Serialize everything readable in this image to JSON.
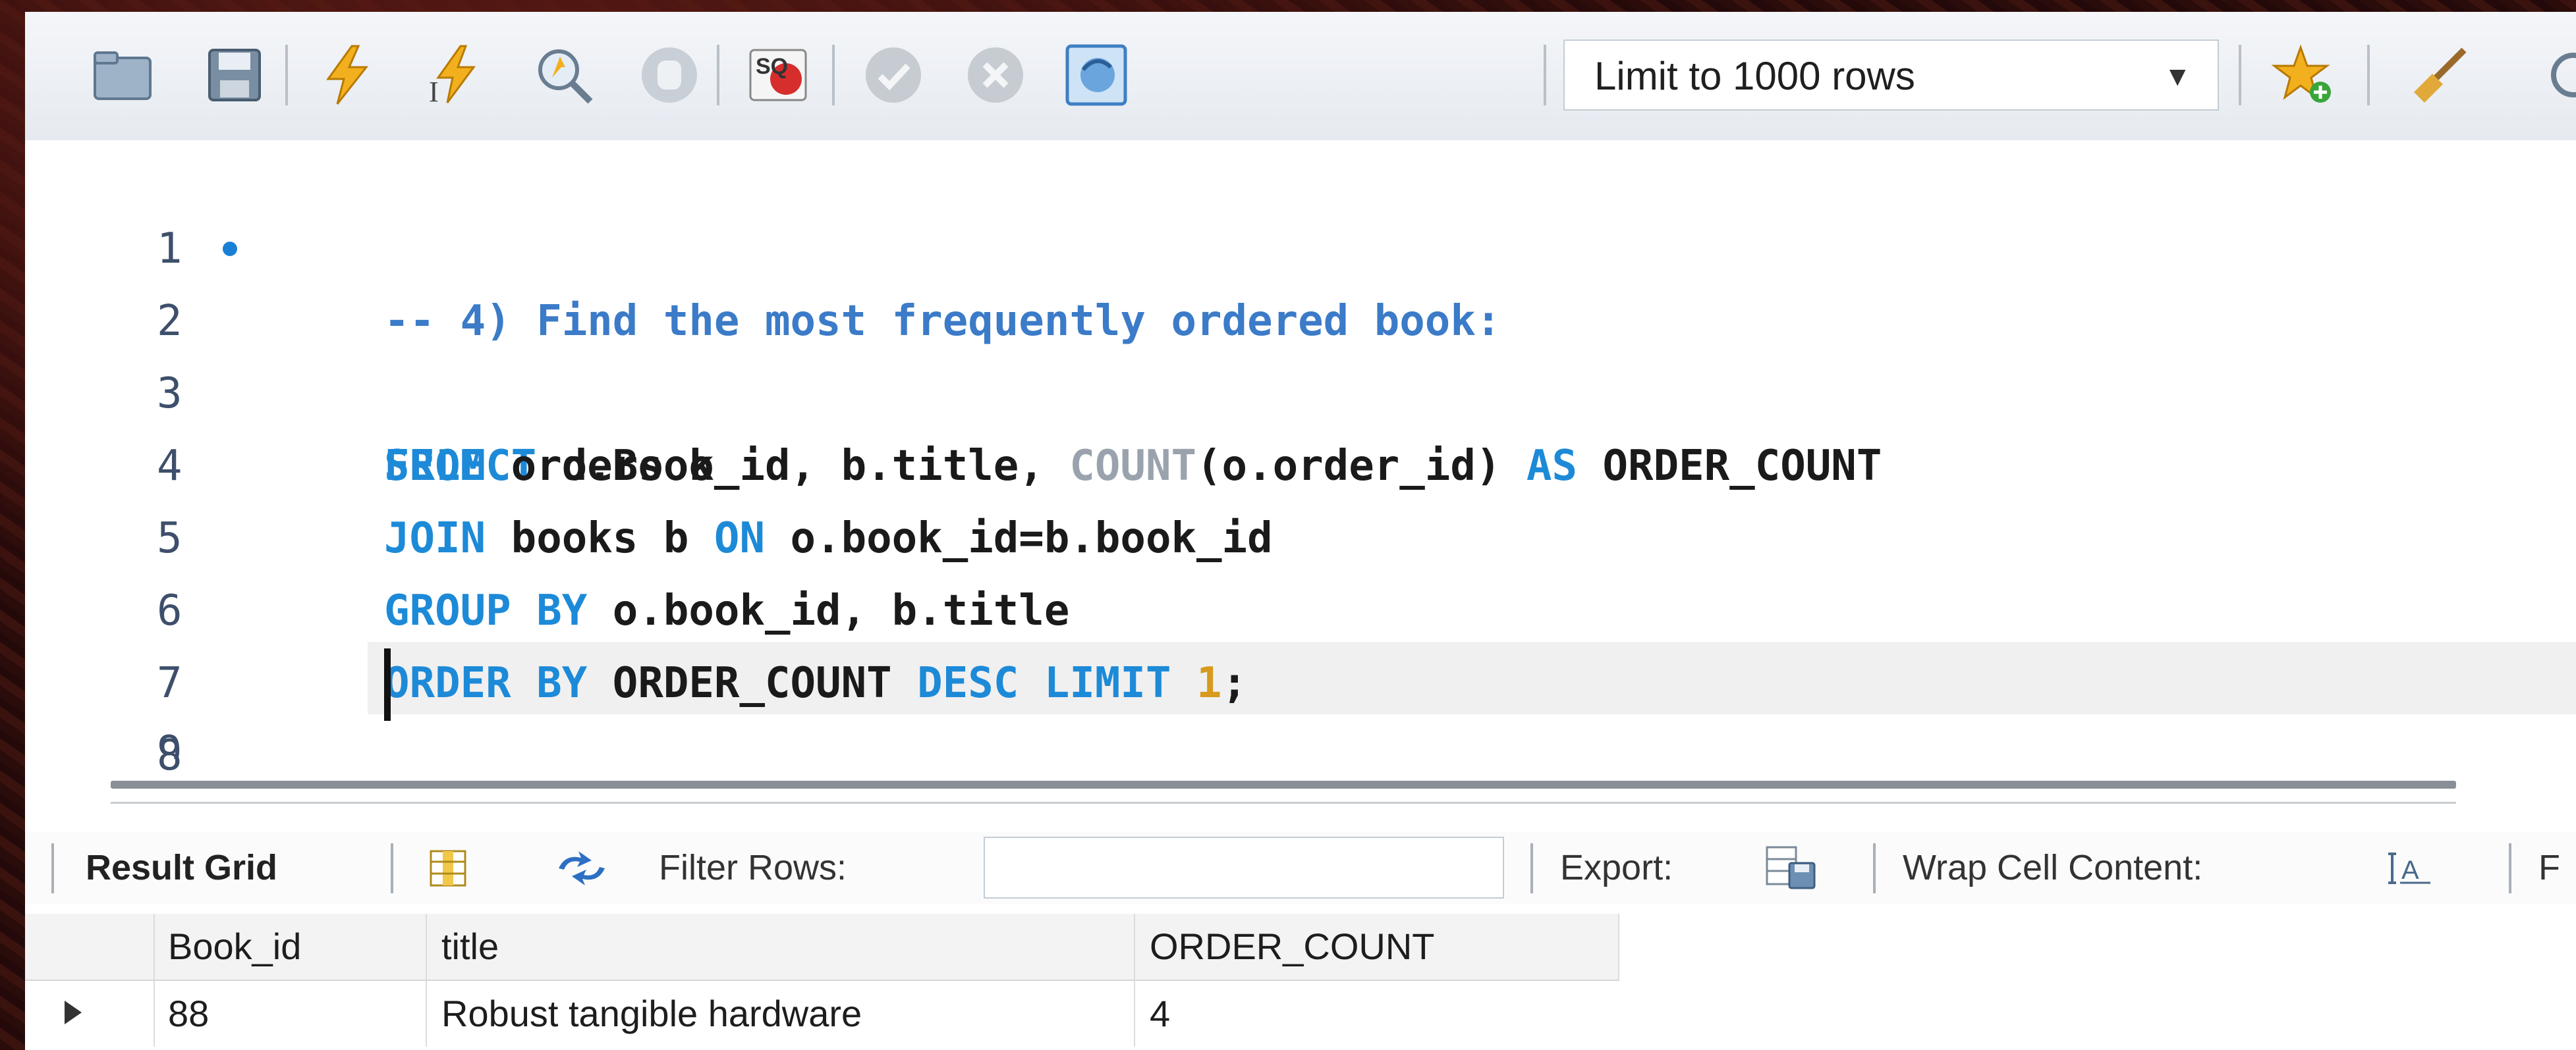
{
  "toolbar": {
    "limit_select": "Limit to 1000 rows"
  },
  "editor": {
    "line_numbers": [
      "1",
      "2",
      "3",
      "4",
      "5",
      "6",
      "7",
      "8",
      "9"
    ],
    "line1": "-- 4) Find the most frequently ordered book:",
    "line2": {
      "kw1": "SELECT",
      "t1": " o.Book_id, b.title, ",
      "fn": "COUNT",
      "t2": "(o.order_id) ",
      "kw2": "AS",
      "t3": " ORDER_COUNT"
    },
    "line3": {
      "kw": "FROM",
      "t": " orders o"
    },
    "line4": {
      "kw1": "JOIN",
      "t1": " books b ",
      "kw2": "ON",
      "t2": " o.book_id=b.book_id"
    },
    "line5": {
      "kw": "GROUP BY",
      "t": " o.book_id, b.title"
    },
    "line6": {
      "kw1": "ORDER BY",
      "t1": " ORDER_COUNT ",
      "kw2": "DESC LIMIT",
      "sp": " ",
      "num": "1",
      "t2": ";"
    }
  },
  "result_toolbar": {
    "result_grid": "Result Grid",
    "filter_rows": "Filter Rows:",
    "export": "Export:",
    "wrap_cell_content": "Wrap Cell Content:",
    "trailing": "F"
  },
  "grid": {
    "columns": [
      "Book_id",
      "title",
      "ORDER_COUNT"
    ],
    "rows": [
      [
        "88",
        "Robust tangible hardware",
        "4"
      ]
    ]
  }
}
